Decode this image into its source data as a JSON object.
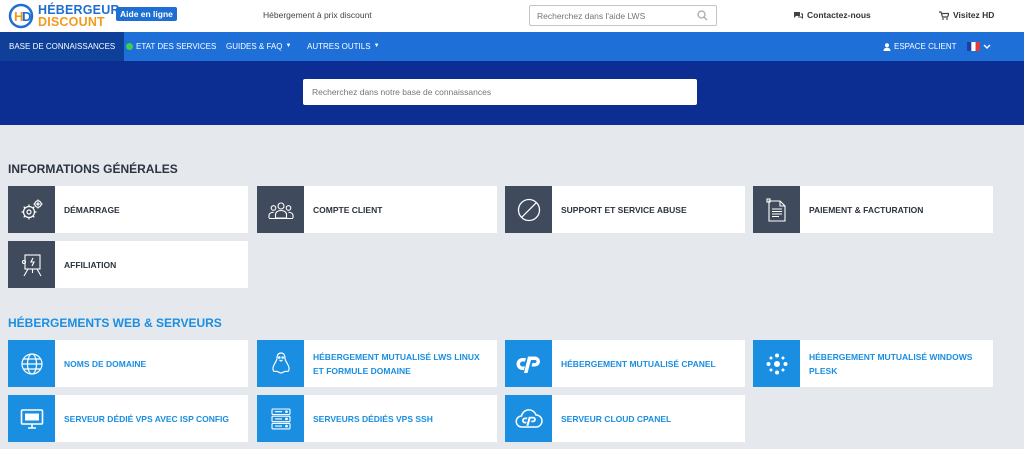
{
  "header": {
    "logo_line1": "HÉBERGEUR",
    "logo_line2": "DISCOUNT",
    "logo_badge": "Aide en ligne",
    "tagline": "Hébergement à prix discount",
    "search_placeholder": "Recherchez dans l'aide LWS",
    "contact_label": "Contactez-nous",
    "visit_label": "Visitez HD"
  },
  "nav": {
    "items": [
      {
        "label": "BASE DE CONNAISSANCES"
      },
      {
        "label": "ETAT DES SERVICES"
      },
      {
        "label": "GUIDES & FAQ"
      },
      {
        "label": "AUTRES OUTILS"
      }
    ],
    "client_label": "ESPACE CLIENT"
  },
  "hero": {
    "search_placeholder": "Recherchez dans notre base de connaissances"
  },
  "sections": [
    {
      "title": "INFORMATIONS GÉNÉRALES",
      "cards": [
        {
          "label": "DÉMARRAGE",
          "icon": "gears-icon"
        },
        {
          "label": "COMPTE CLIENT",
          "icon": "users-icon"
        },
        {
          "label": "SUPPORT ET SERVICE ABUSE",
          "icon": "ban-icon"
        },
        {
          "label": "PAIEMENT & FACTURATION",
          "icon": "invoice-icon"
        },
        {
          "label": "AFFILIATION",
          "icon": "affiliation-icon"
        }
      ]
    },
    {
      "title": "HÉBERGEMENTS WEB & SERVEURS",
      "cards": [
        {
          "label": "NOMS DE DOMAINE",
          "icon": "globe-icon"
        },
        {
          "label": "HÉBERGEMENT MUTUALISÉ LWS LINUX ET FORMULE DOMAINE",
          "icon": "linux-icon"
        },
        {
          "label": "HÉBERGEMENT MUTUALISÉ CPANEL",
          "icon": "cpanel-icon"
        },
        {
          "label": "HÉBERGEMENT MUTUALISÉ WINDOWS PLESK",
          "icon": "plesk-icon"
        },
        {
          "label": "SERVEUR DÉDIÉ VPS AVEC ISP CONFIG",
          "icon": "monitor-icon"
        },
        {
          "label": "SERVEURS DÉDIÉS VPS SSH",
          "icon": "server-icon"
        },
        {
          "label": "SERVEUR CLOUD CPANEL",
          "icon": "cloud-cpanel-icon"
        }
      ]
    }
  ],
  "colors": {
    "nav_blue": "#1e6fd8",
    "nav_active": "#0e3f99",
    "hero_blue": "#0c2d92",
    "card_icon_dark": "#3f4a5c",
    "card_icon_blue": "#1a8ee0",
    "logo_orange": "#f29a1c",
    "status_green": "#3fcf4f"
  }
}
